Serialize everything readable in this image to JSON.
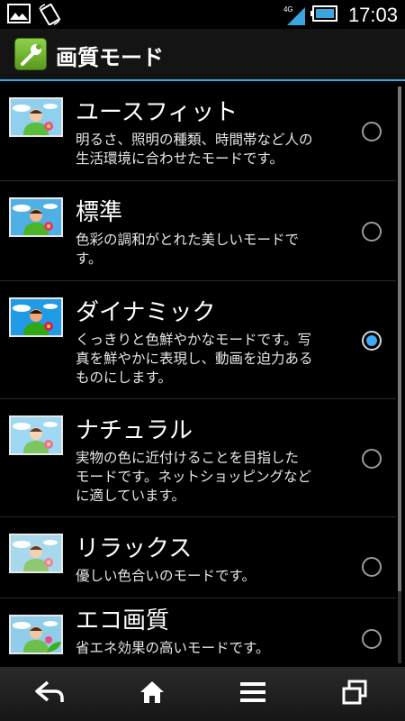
{
  "status_bar": {
    "time": "17:03",
    "network": "4G",
    "icons": [
      "gallery-notification-icon",
      "screen-rotate-notification-icon",
      "signal-icon",
      "battery-icon"
    ]
  },
  "header": {
    "title": "画質モード",
    "icon": "wrench-settings-icon",
    "accent_color": "#3da9d8"
  },
  "modes": [
    {
      "title": "ユースフィット",
      "desc_lines": [
        "明るさ、照明の種類、時間帯など人の",
        "生活環境に合わせたモードです。"
      ],
      "selected": false
    },
    {
      "title": "標準",
      "desc_lines": [
        "色彩の調和がとれた美しいモードで",
        "す。"
      ],
      "selected": false
    },
    {
      "title": "ダイナミック",
      "desc_lines": [
        "くっきりと色鮮やかなモードです。写",
        "真を鮮やかに表現し、動画を迫力ある",
        "ものにします。"
      ],
      "selected": true
    },
    {
      "title": "ナチュラル",
      "desc_lines": [
        "実物の色に近付けることを目指した",
        "モードです。ネットショッピングなど",
        "に適しています。"
      ],
      "selected": false
    },
    {
      "title": "リラックス",
      "desc_lines": [
        "優しい色合いのモードです。"
      ],
      "selected": false
    },
    {
      "title": "エコ画質",
      "desc_lines": [
        "省エネ効果の高いモードです。"
      ],
      "selected": false
    }
  ],
  "nav_bar": {
    "buttons": [
      "back-icon",
      "home-icon",
      "menu-icon",
      "recent-apps-icon"
    ]
  }
}
